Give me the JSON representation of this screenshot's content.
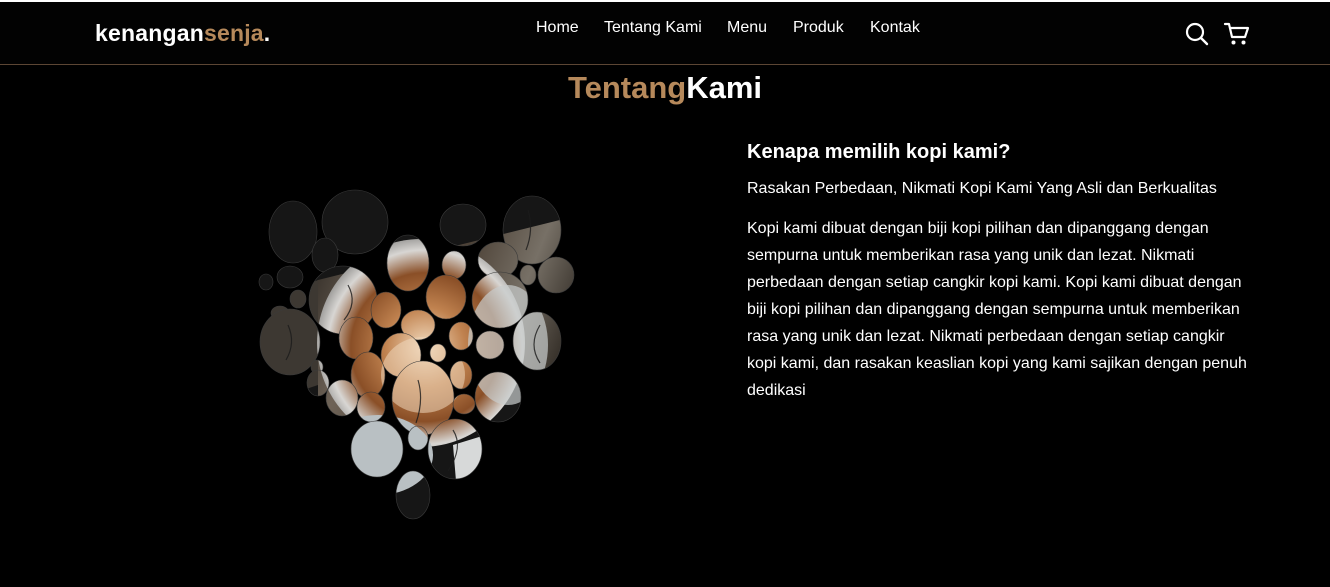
{
  "brand": {
    "name_part1": "kenangan",
    "name_part2": "senja",
    "name_suffix": "."
  },
  "nav": {
    "links": [
      {
        "label": "Home"
      },
      {
        "label": "Tentang Kami"
      },
      {
        "label": "Menu"
      },
      {
        "label": "Produk"
      },
      {
        "label": "Kontak"
      }
    ],
    "icons": [
      "search-icon",
      "cart-icon"
    ]
  },
  "section": {
    "title_part1": "Tentang",
    "title_part2": "Kami"
  },
  "about": {
    "heading": "Kenapa memilih kopi kami?",
    "lead": "Rasakan Perbedaan, Nikmati Kopi Kami Yang Asli dan Berkualitas",
    "body": "Kopi kami dibuat dengan biji kopi pilihan dan dipanggang dengan sempurna untuk memberikan rasa yang unik dan lezat. Nikmati perbedaan dengan setiap cangkir kopi kami. Kopi kami dibuat dengan biji kopi pilihan dan dipanggang dengan sempurna untuk memberikan rasa yang unik dan lezat. Nikmati perbedaan dengan setiap cangkir kopi kami, dan rasakan keaslian kopi yang kami sajikan dengan penuh dedikasi"
  },
  "colors": {
    "accent": "#b6895b",
    "background": "#000000",
    "text": "#ffffff"
  }
}
